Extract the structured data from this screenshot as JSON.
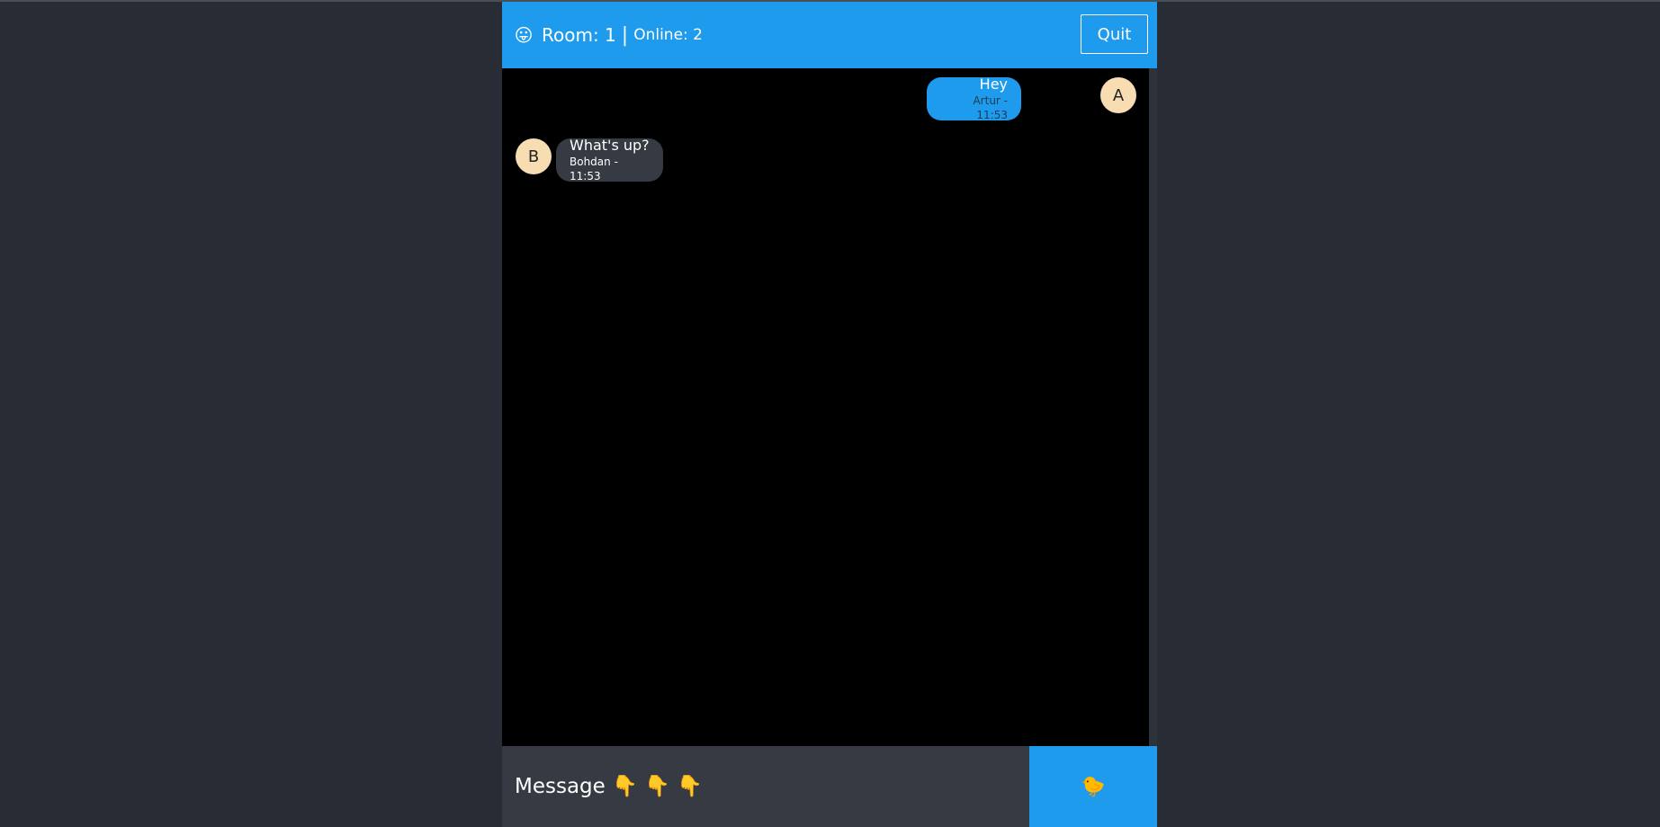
{
  "header": {
    "room_icon": "😛",
    "room_label": "Room: 1",
    "separator": "|",
    "online_label": "Online: 2",
    "quit_label": "Quit"
  },
  "messages": [
    {
      "side": "own",
      "avatar": "A",
      "text": "Hey",
      "meta": "Artur - 11:53"
    },
    {
      "side": "other",
      "avatar": "B",
      "text": "What's up?",
      "meta": "Bohdan - 11:53"
    }
  ],
  "composer": {
    "placeholder": "Message 👇 👇 👇",
    "send_icon": "🐤"
  },
  "colors": {
    "accent": "#1e9bed",
    "page_bg": "#282c34",
    "chat_bg": "#000000",
    "other_bubble": "#363a43",
    "avatar_bg": "#f8ddb3"
  }
}
